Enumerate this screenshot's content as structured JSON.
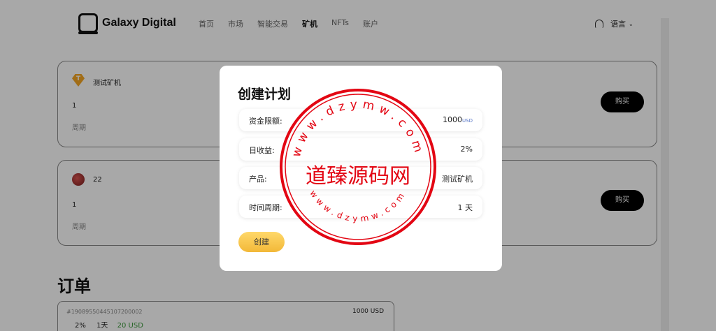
{
  "nav": {
    "brand": "Galaxy Digital",
    "menu": [
      "首页",
      "市场",
      "智能交易",
      "矿机",
      "NFTs",
      "账户"
    ],
    "active_index": 3,
    "language": "语言"
  },
  "products": [
    {
      "name": "测试矿机",
      "icon": "tether-icon",
      "value": "1",
      "label": "周期",
      "button": "购买"
    },
    {
      "name": "22",
      "icon": "avatar-icon",
      "value": "1",
      "label": "周期",
      "button": "购买"
    }
  ],
  "orders": {
    "title": "订单",
    "items": [
      {
        "id": "#19089550445107200002",
        "amount": "1000 USD",
        "rate": "2%",
        "period": "1天",
        "profit": "20 USD"
      }
    ]
  },
  "modal": {
    "title": "创建计划",
    "fields": [
      {
        "label": "资金限额:",
        "value": "1000",
        "unit": "USD"
      },
      {
        "label": "日收益:",
        "value": "2%"
      },
      {
        "label": "产品:",
        "value": "测试矿机"
      },
      {
        "label": "时间周期:",
        "value": "1 天"
      }
    ],
    "create_button": "创建"
  },
  "watermark": {
    "center_text": "道臻源码网",
    "ring_text": "www.dzymw.com",
    "color": "#e30613"
  }
}
